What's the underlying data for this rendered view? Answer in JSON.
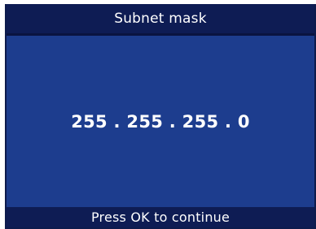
{
  "header": {
    "title": "Subnet mask"
  },
  "main": {
    "value": "255 . 255 . 255 . 0"
  },
  "footer": {
    "hint": "Press OK to continue"
  },
  "colors": {
    "background": "#1d3d8e",
    "bars": "#0e1c54",
    "text": "#ffffff"
  }
}
